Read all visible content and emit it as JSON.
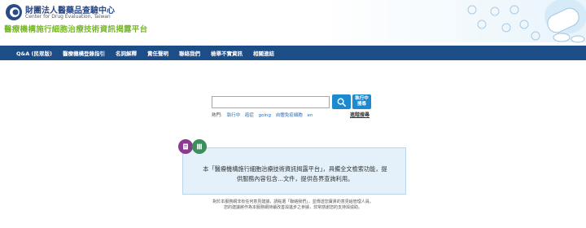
{
  "header": {
    "org_name_cn": "財團法人醫藥品查驗中心",
    "org_name_en": "Center for Drug Evaluation, Taiwan",
    "platform_title": "醫療機構施行細胞治療技術資訊揭露平台"
  },
  "nav": {
    "items": [
      "Q&A (民眾版)",
      "醫療機構登錄指引",
      "名詞解釋",
      "責任聲明",
      "聯絡我們",
      "檢舉不實資訊",
      "相關連結"
    ]
  },
  "search": {
    "input_value": "",
    "exec_label_line1": "執行中",
    "exec_label_line2": "搜尋",
    "popular_label": "熱門:",
    "popular_tags": [
      "執行中",
      "癌症",
      "going",
      "自體免疫細胞",
      "en"
    ],
    "advanced_label": "進階搜尋"
  },
  "info": {
    "line1": "本「醫療機構施行細胞治療技術資訊揭露平台」，具備全文檢索功能，提",
    "line2": "供服務內容包含...文件，提供各界查詢利用。"
  },
  "footer": {
    "line1": "對於本服務網非有任何意見建議，請點選「聯絡我們」，並傳送您寶貴的意見給管理人員。",
    "line2": "您的建議將作為本服務網持續改善與進步之參據，非常感謝您的支持與協助。"
  },
  "colors": {
    "nav_bg": "#1d4d87",
    "accent_green": "#7ab82e",
    "button_blue": "#1b8ad0",
    "info_bg": "#e4f1fa"
  }
}
